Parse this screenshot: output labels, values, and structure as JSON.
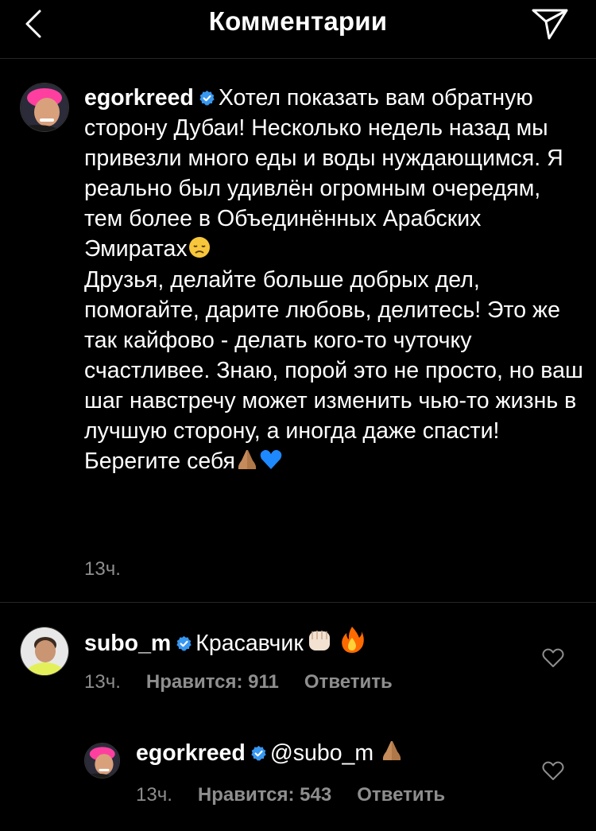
{
  "header": {
    "title": "Комментарии",
    "back_icon": "chevron-left-icon",
    "send_icon": "paper-plane-icon"
  },
  "caption": {
    "username": "egorkreed",
    "text_part1": "Хотел показать вам обратную сторону Дубаи! Несколько недель назад мы привезли много еды и воды нуждающимся. Я реально был удивлён огромным очередям, тем более в Объединённых Арабских Эмиратах",
    "text_part2": "Друзья, делайте больше добрых дел, помогайте, дарите любовь, делитесь! Это же так кайфово - делать кого-то чуточку счастливее. Знаю, порой это не просто, но ваш шаг навстречу может изменить чью-то жизнь в лучшую сторону, а иногда даже спасти! Берегите себя",
    "time": "13ч."
  },
  "comments": [
    {
      "username": "subo_m",
      "text": "Красавчик",
      "time": "13ч.",
      "likes": "Нравится: 911",
      "reply": "Ответить"
    },
    {
      "username": "egorkreed",
      "text": "@subo_m",
      "time": "13ч.",
      "likes": "Нравится: 543",
      "reply": "Ответить"
    }
  ],
  "colors": {
    "background": "#000000",
    "secondary_text": "#8e8e8e",
    "verified": "#3897f0",
    "divider": "#262626"
  }
}
